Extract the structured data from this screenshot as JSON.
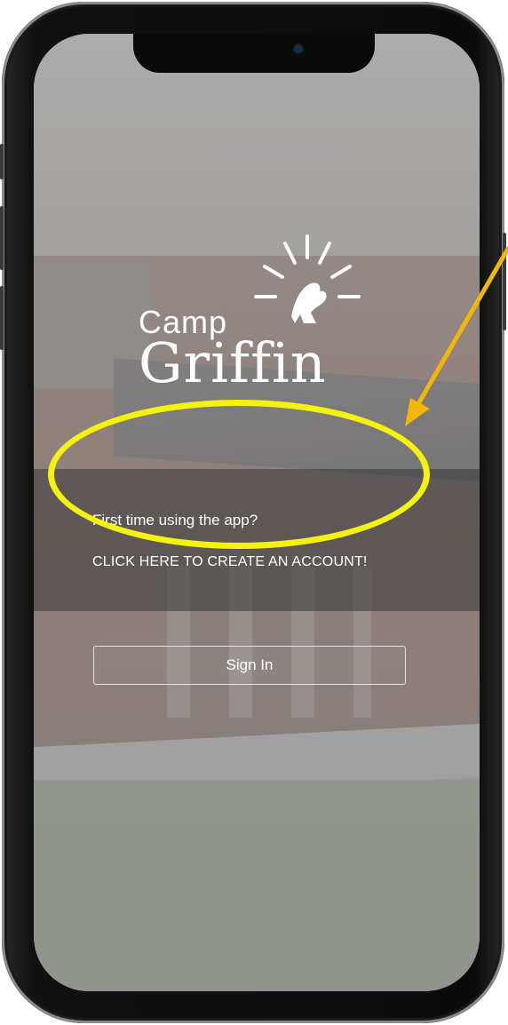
{
  "app": {
    "logo_line1": "Camp",
    "logo_line2": "Griffin"
  },
  "onboarding": {
    "question": "First time using the app?",
    "create_account_link": "CLICK HERE TO CREATE AN ACCOUNT!"
  },
  "auth": {
    "sign_in_label": "Sign In"
  },
  "annotations": {
    "highlight_color": "#f4f20e",
    "arrow_color": "#f2b705"
  },
  "icons": {
    "logo_mark": "griffin-sunburst-icon",
    "front_camera": "camera-icon"
  }
}
